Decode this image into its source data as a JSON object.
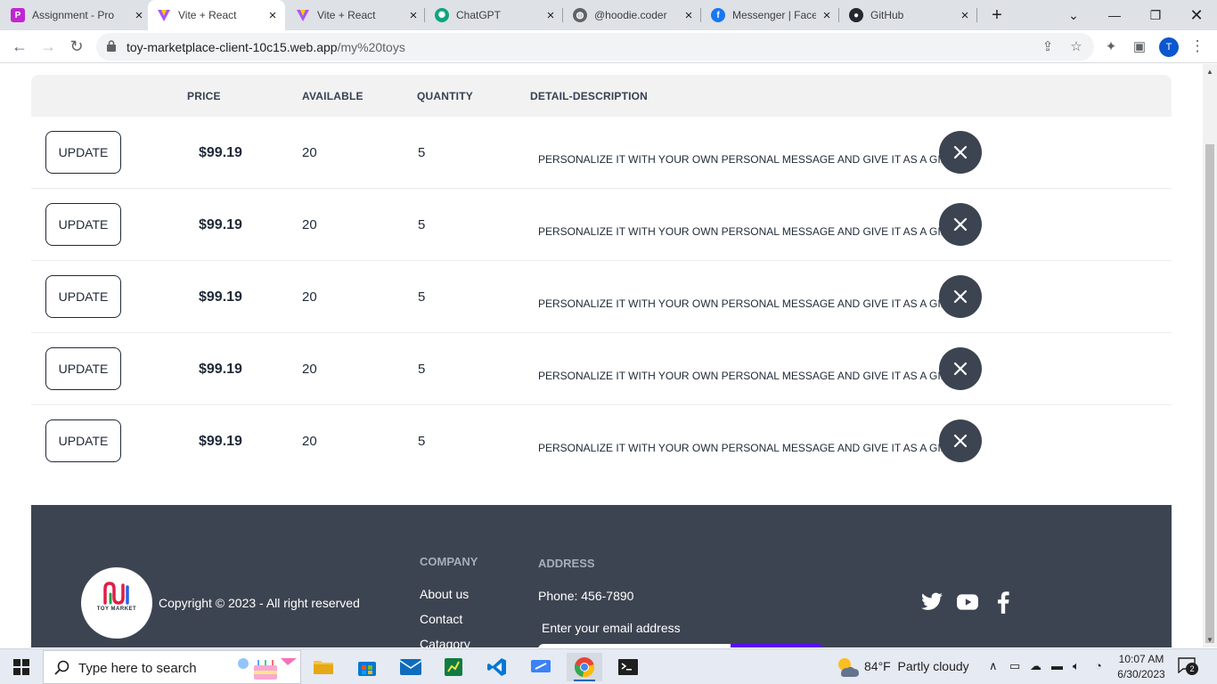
{
  "browser": {
    "tabs": [
      {
        "title": "Assignment - Pro",
        "icon": "assignment-favicon",
        "color": "#c026d3"
      },
      {
        "title": "Vite + React",
        "icon": "vite-favicon",
        "active": true
      },
      {
        "title": "Vite + React",
        "icon": "vite-favicon"
      },
      {
        "title": "ChatGPT",
        "icon": "chatgpt-favicon"
      },
      {
        "title": "@hoodie.coder",
        "icon": "globe-favicon"
      },
      {
        "title": "Messenger | Face",
        "icon": "facebook-favicon"
      },
      {
        "title": "GitHub",
        "icon": "github-favicon"
      }
    ],
    "new_tab_label": "+",
    "url_host": "toy-marketplace-client-10c15.web.app",
    "url_path": "/my%20toys",
    "profile_initial": "T"
  },
  "table": {
    "headers": {
      "price": "PRICE",
      "available": "AVAILABLE",
      "quantity": "QUANTITY",
      "description": "DETAIL-DESCRIPTION"
    },
    "update_label": "UPDATE",
    "rows": [
      {
        "price": "$99.19",
        "available": "20",
        "quantity": "5",
        "description": "PERSONALIZE IT WITH YOUR OWN PERSONAL MESSAGE AND GIVE IT AS A GIFT."
      },
      {
        "price": "$99.19",
        "available": "20",
        "quantity": "5",
        "description": "PERSONALIZE IT WITH YOUR OWN PERSONAL MESSAGE AND GIVE IT AS A GIFT."
      },
      {
        "price": "$99.19",
        "available": "20",
        "quantity": "5",
        "description": "PERSONALIZE IT WITH YOUR OWN PERSONAL MESSAGE AND GIVE IT AS A GIFT."
      },
      {
        "price": "$99.19",
        "available": "20",
        "quantity": "5",
        "description": "PERSONALIZE IT WITH YOUR OWN PERSONAL MESSAGE AND GIVE IT AS A GIFT."
      },
      {
        "price": "$99.19",
        "available": "20",
        "quantity": "5",
        "description": "PERSONALIZE IT WITH YOUR OWN PERSONAL MESSAGE AND GIVE IT AS A GIFT."
      }
    ]
  },
  "footer": {
    "logo_text": "TOY MARKET",
    "copyright": "Copyright © 2023 - All right reserved",
    "company_heading": "COMPANY",
    "company_links": [
      "About us",
      "Contact",
      "Catagory"
    ],
    "address_heading": "ADDRESS",
    "phone": "Phone: 456-7890",
    "email_label": "Enter your email address",
    "socials": [
      "twitter-icon",
      "youtube-icon",
      "facebook-icon"
    ]
  },
  "taskbar": {
    "search_placeholder": "Type here to search",
    "weather_temp": "84°F",
    "weather_desc": "Partly cloudy",
    "time": "10:07 AM",
    "date": "6/30/2023",
    "notification_count": "2"
  },
  "colors": {
    "dark": "#3d4451",
    "accent": "#570df8",
    "header_bg": "#f2f2f2"
  }
}
